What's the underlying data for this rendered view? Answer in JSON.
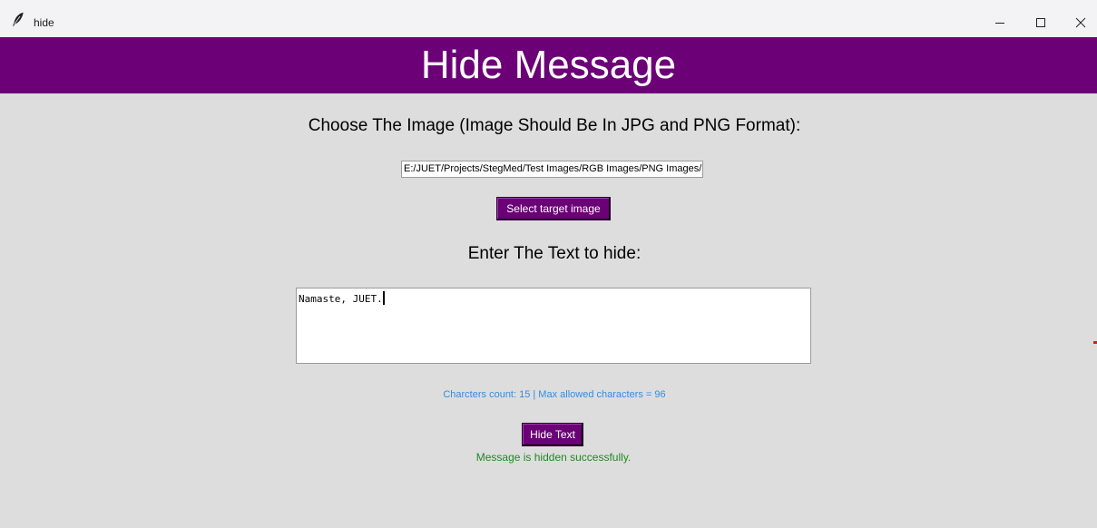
{
  "window": {
    "title": "hide",
    "app_icon": "feather-icon",
    "controls": {
      "minimize": "minimize-icon",
      "maximize": "maximize-icon",
      "close": "close-icon"
    }
  },
  "header": {
    "title": "Hide Message",
    "background": "#6b0077"
  },
  "image_section": {
    "label": "Choose The Image (Image Should Be In JPG and PNG Format):",
    "path_value": "E:/JUET/Projects/StegMed/Test Images/RGB Images/PNG Images/",
    "select_button_label": "Select target image"
  },
  "text_section": {
    "label": "Enter The Text to hide:",
    "text_value": "Namaste, JUET."
  },
  "counter": {
    "text": "Charcters count: 15 | Max allowed characters = 96",
    "color": "#2f8de8"
  },
  "actions": {
    "hide_button_label": "Hide Text"
  },
  "status": {
    "message": "Message is hidden successfully.",
    "color": "#1f8a1f"
  }
}
